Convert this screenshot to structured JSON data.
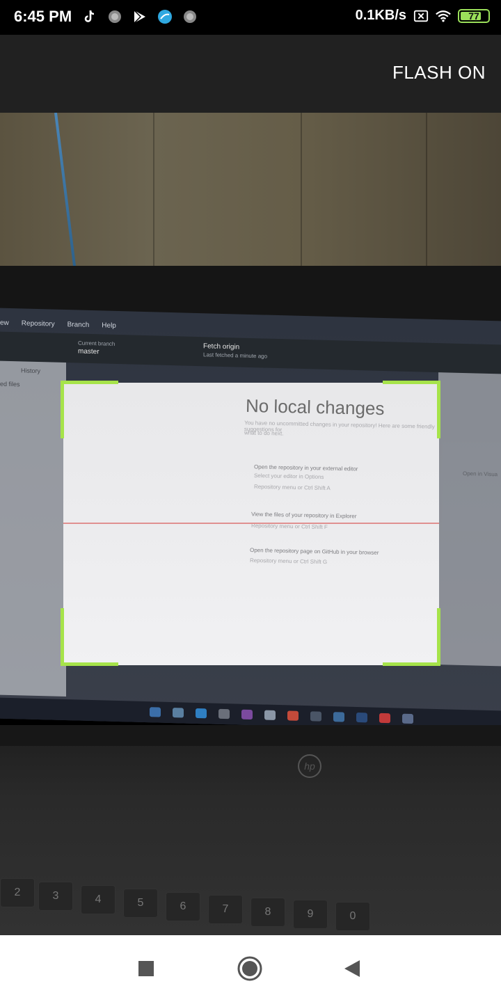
{
  "status_bar": {
    "time": "6:45 PM",
    "net_speed": "0.1KB/s",
    "battery": "77",
    "battery_level": 0.77,
    "icons": [
      "tiktok-icon",
      "app-icon",
      "play-store-icon",
      "bubble-icon",
      "app-icon-2"
    ]
  },
  "app_bar": {
    "flash_label": "FLASH ON"
  },
  "camera_preview": {
    "desktop_menu": [
      "ew",
      "Repository",
      "Branch",
      "Help"
    ],
    "toolbar": {
      "branch_label": "Current branch",
      "branch_value": "master",
      "fetch_label": "Fetch origin",
      "fetch_sub": "Last fetched a minute ago"
    },
    "left_pane": {
      "history": "History",
      "changed_files": "ed files"
    },
    "scan_window": {
      "title": "No local changes",
      "subtitle_1": "You have no uncommitted changes in your repository! Here are some friendly suggestions for",
      "subtitle_2": "what to do next.",
      "item1_title": "Open the repository in your external editor",
      "item1_sub": "Select your editor in Options",
      "item1_hint": "Repository menu or  Ctrl  Shift  A",
      "item2_title": "View the files of your repository in Explorer",
      "item2_hint": "Repository menu or  Ctrl  Shift  F",
      "item3_title": "Open the repository page on GitHub in your browser",
      "item3_hint": "Repository menu or  Ctrl  Shift  G"
    },
    "right_pane": {
      "open_label": "Open in Visua"
    },
    "brand": "hp",
    "keys": [
      "2",
      "3",
      "4",
      "5",
      "6",
      "7",
      "8",
      "9",
      "0"
    ]
  },
  "nav_bar": {
    "recents": "recents-button",
    "home": "home-button",
    "back": "back-button"
  },
  "colors": {
    "status_bg": "#000000",
    "app_bar_bg": "#212121",
    "scan_corner": "#a6e34a",
    "scan_line": "#e09090",
    "nav_bg": "#ffffff"
  }
}
